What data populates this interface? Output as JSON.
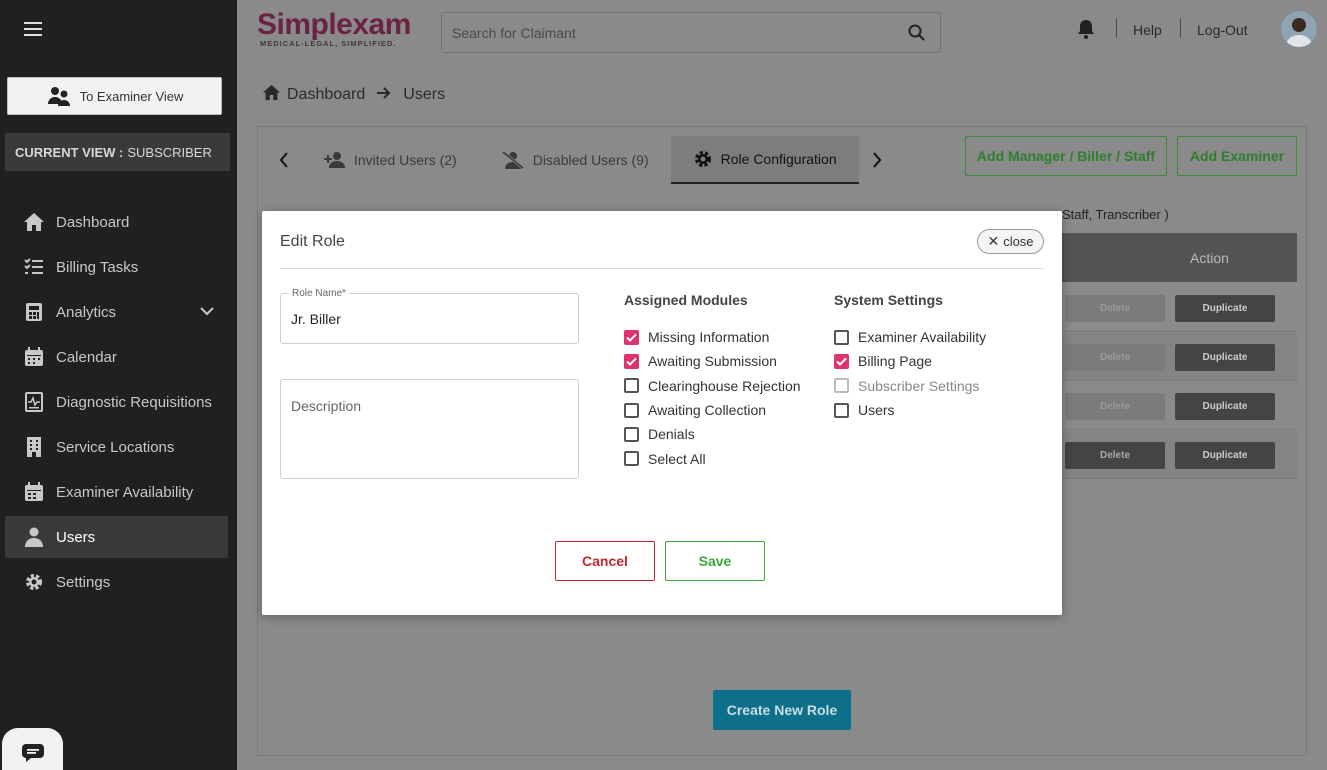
{
  "brand": {
    "name": "Simplexam",
    "tagline": "MEDICAL-LEGAL, SIMPLIFIED.",
    "primary_color": "#6b2344"
  },
  "sidebar": {
    "examiner_view_label": "To Examiner View",
    "current_view_label": "CURRENT VIEW :",
    "current_view_value": "SUBSCRIBER",
    "items": [
      {
        "label": "Dashboard",
        "icon": "home-icon"
      },
      {
        "label": "Billing Tasks",
        "icon": "list-icon"
      },
      {
        "label": "Analytics",
        "icon": "calculator-icon"
      },
      {
        "label": "Calendar",
        "icon": "calendar-icon"
      },
      {
        "label": "Diagnostic Requisitions",
        "icon": "report-icon"
      },
      {
        "label": "Service Locations",
        "icon": "building-icon"
      },
      {
        "label": "Examiner Availability",
        "icon": "calendar-check-icon"
      },
      {
        "label": "Users",
        "icon": "user-icon",
        "active": true
      },
      {
        "label": "Settings",
        "icon": "gear-icon"
      }
    ]
  },
  "header": {
    "search_placeholder": "Search for Claimant",
    "help_label": "Help",
    "logout_label": "Log-Out"
  },
  "breadcrumb": {
    "home": "Dashboard",
    "current": "Users"
  },
  "tabs": [
    {
      "label": "Invited Users (2)",
      "icon": "user-plus-icon"
    },
    {
      "label": "Disabled Users (9)",
      "icon": "user-slash-icon"
    },
    {
      "label": "Role Configuration",
      "icon": "gear-icon",
      "active": true
    }
  ],
  "actions": {
    "add_staff_label": "Add Manager / Biller / Staff",
    "add_examiner_label": "Add Examiner",
    "create_role_label": "Create New Role"
  },
  "background_table": {
    "info_tail": "Staff, Transcriber )",
    "action_header": "Action",
    "rows": [
      {
        "delete_label": "Delete",
        "duplicate_label": "Duplicate"
      },
      {
        "delete_label": "Delete",
        "duplicate_label": "Duplicate"
      },
      {
        "delete_label": "Delete",
        "duplicate_label": "Duplicate"
      },
      {
        "delete_label": "Delete",
        "duplicate_label": "Duplicate"
      }
    ]
  },
  "modal": {
    "title": "Edit Role",
    "close_label": "close",
    "role_name_label": "Role Name*",
    "role_name_value": "Jr. Biller",
    "description_placeholder": "Description",
    "assigned_modules_title": "Assigned Modules",
    "assigned_modules": [
      {
        "label": "Missing Information",
        "checked": true
      },
      {
        "label": "Awaiting Submission",
        "checked": true
      },
      {
        "label": "Clearinghouse Rejection",
        "checked": false
      },
      {
        "label": "Awaiting Collection",
        "checked": false
      },
      {
        "label": "Denials",
        "checked": false
      },
      {
        "label": "Select All",
        "checked": false
      }
    ],
    "system_settings_title": "System Settings",
    "system_settings": [
      {
        "label": "Examiner Availability",
        "checked": false
      },
      {
        "label": "Billing Page",
        "checked": true
      },
      {
        "label": "Subscriber Settings",
        "checked": false,
        "disabled": true
      },
      {
        "label": "Users",
        "checked": false
      }
    ],
    "cancel_label": "Cancel",
    "save_label": "Save"
  },
  "colors": {
    "checkbox_checked": "#e0336b",
    "cancel": "#c0282d",
    "save": "#3aa83a",
    "create_button": "#0d6f8a"
  }
}
